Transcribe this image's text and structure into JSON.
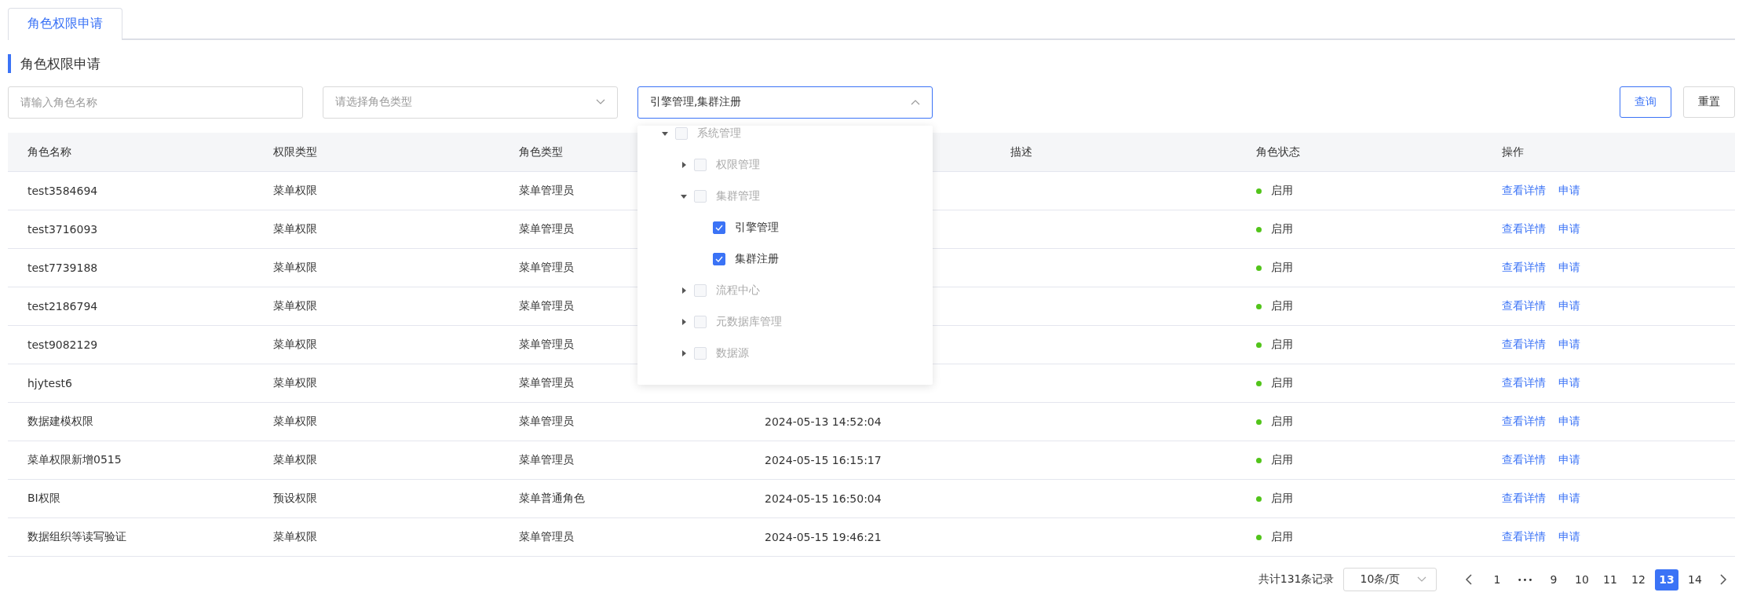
{
  "tabs": [
    {
      "label": "角色权限申请",
      "selected": true
    }
  ],
  "section_title": "角色权限申请",
  "filters": {
    "name": {
      "placeholder": "请输入角色名称"
    },
    "role_type": {
      "placeholder": "请选择角色类型"
    },
    "permission": {
      "value": "引擎管理,集群注册",
      "open": true,
      "tree": [
        {
          "label": "系统管理",
          "expanded": true,
          "checked": false,
          "disabled": true,
          "children": [
            {
              "label": "权限管理",
              "expanded": false,
              "checked": false,
              "disabled": true
            },
            {
              "label": "集群管理",
              "expanded": true,
              "checked": false,
              "disabled": true,
              "children": [
                {
                  "label": "引擎管理",
                  "checked": true,
                  "disabled": false
                },
                {
                  "label": "集群注册",
                  "checked": true,
                  "disabled": false
                }
              ]
            },
            {
              "label": "流程中心",
              "expanded": false,
              "checked": false,
              "disabled": true
            },
            {
              "label": "元数据库管理",
              "expanded": false,
              "checked": false,
              "disabled": true
            },
            {
              "label": "数据源",
              "expanded": false,
              "checked": false,
              "disabled": true
            }
          ]
        }
      ]
    }
  },
  "buttons": [
    {
      "label": "查询",
      "kind": "primary"
    },
    {
      "label": "重置",
      "kind": "default"
    }
  ],
  "table": {
    "columns": [
      {
        "label": "角色名称"
      },
      {
        "label": "权限类型"
      },
      {
        "label": "角色类型"
      },
      {},
      {
        "label": "描述"
      },
      {
        "label": "角色状态"
      },
      {
        "label": "操作"
      }
    ],
    "rows": [
      {
        "name": "test3584694",
        "permission_type": "菜单权限",
        "role_type": "菜单管理员",
        "status": "启用",
        "actions": [
          "查看详情",
          "申请"
        ]
      },
      {
        "name": "test3716093",
        "permission_type": "菜单权限",
        "role_type": "菜单管理员",
        "status": "启用",
        "actions": [
          "查看详情",
          "申请"
        ]
      },
      {
        "name": "test7739188",
        "permission_type": "菜单权限",
        "role_type": "菜单管理员",
        "status": "启用",
        "actions": [
          "查看详情",
          "申请"
        ]
      },
      {
        "name": "test2186794",
        "permission_type": "菜单权限",
        "role_type": "菜单管理员",
        "status": "启用",
        "actions": [
          "查看详情",
          "申请"
        ]
      },
      {
        "name": "test9082129",
        "permission_type": "菜单权限",
        "role_type": "菜单管理员",
        "status": "启用",
        "actions": [
          "查看详情",
          "申请"
        ]
      },
      {
        "name": "hjytest6",
        "permission_type": "菜单权限",
        "role_type": "菜单管理员",
        "status": "启用",
        "actions": [
          "查看详情",
          "申请"
        ]
      },
      {
        "name": "数据建模权限",
        "permission_type": "菜单权限",
        "role_type": "菜单管理员",
        "time": "2024-05-13 14:52:04",
        "status": "启用",
        "actions": [
          "查看详情",
          "申请"
        ]
      },
      {
        "name": "菜单权限新增0515",
        "permission_type": "菜单权限",
        "role_type": "菜单管理员",
        "time": "2024-05-15 16:15:17",
        "status": "启用",
        "actions": [
          "查看详情",
          "申请"
        ]
      },
      {
        "name": "BI权限",
        "permission_type": "预设权限",
        "role_type": "菜单普通角色",
        "time": "2024-05-15 16:50:04",
        "status": "启用",
        "actions": [
          "查看详情",
          "申请"
        ]
      },
      {
        "name": "数据组织等读写验证",
        "permission_type": "菜单权限",
        "role_type": "菜单管理员",
        "time": "2024-05-15 19:46:21",
        "status": "启用",
        "actions": [
          "查看详情",
          "申请"
        ]
      }
    ]
  },
  "pagination": {
    "total": "共计131条记录",
    "page_size": "10条/页",
    "pages": [
      {
        "label": "1",
        "kind": "page",
        "selected": false
      },
      {
        "label": "•••",
        "kind": "ellipsis",
        "selected": false
      },
      {
        "label": "9",
        "kind": "page",
        "selected": false
      },
      {
        "label": "10",
        "kind": "page",
        "selected": false
      },
      {
        "label": "11",
        "kind": "page",
        "selected": false
      },
      {
        "label": "12",
        "kind": "page",
        "selected": false
      },
      {
        "label": "13",
        "kind": "page",
        "selected": true
      },
      {
        "label": "14",
        "kind": "page",
        "selected": false
      }
    ]
  }
}
